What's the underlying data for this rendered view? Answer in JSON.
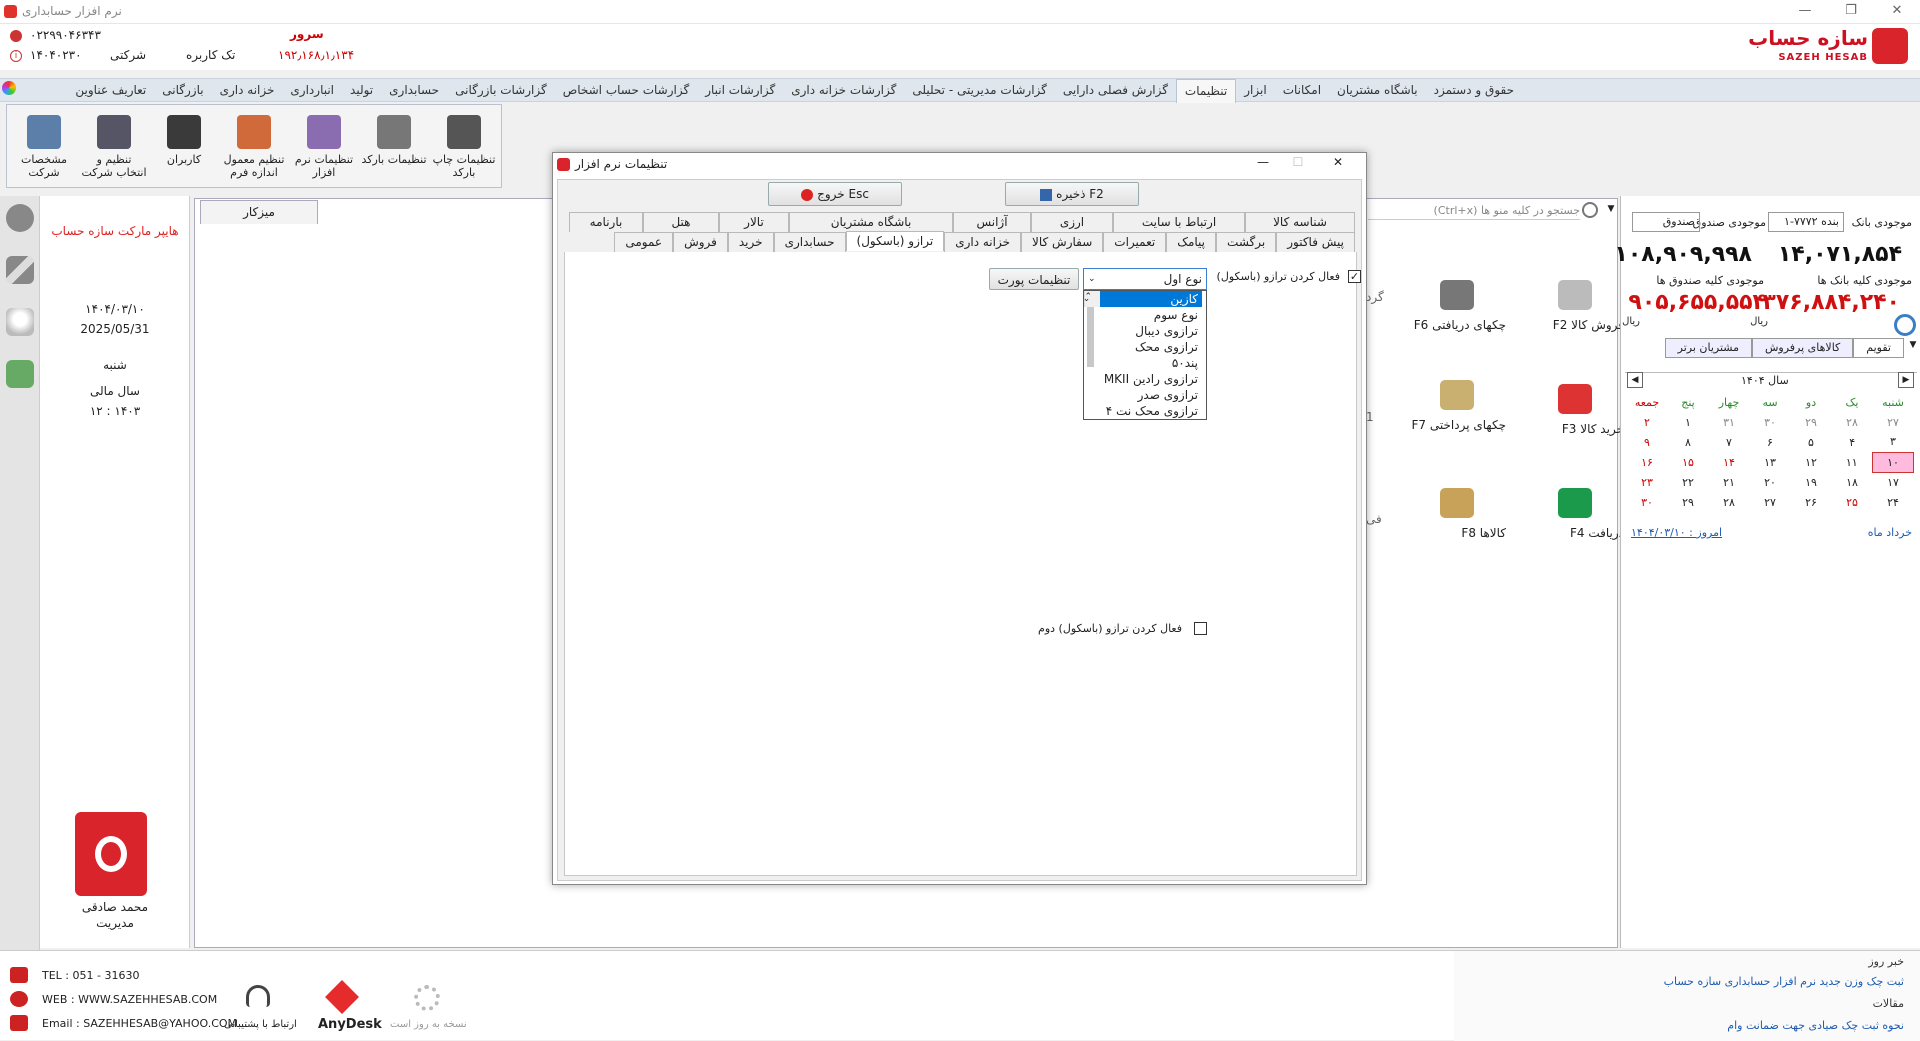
{
  "window": {
    "title": "نرم افزار حسابداری"
  },
  "header": {
    "phone": "۰۲۲۹۹۰۴۶۳۴۳",
    "company": "شرکتی",
    "users": "تک کاربره",
    "date_code": "۱۴۰۴۰۲۳۰",
    "server_label": "سرور",
    "server_ip": "۱۹۲٫۱۶۸٫۱٫۱۳۴",
    "logo_text": "سازه حساب",
    "logo_sub": "SAZEH HESAB"
  },
  "menu": [
    "حقوق و دستمزد",
    "باشگاه مشتریان",
    "امکانات",
    "ابزار",
    "تنظیمات",
    "گزارش فصلی دارایی",
    "گزارشات مدیریتی - تحلیلی",
    "گزارشات خزانه داری",
    "گزارشات انبار",
    "گزارشات حساب اشخاص",
    "گزارشات بازرگانی",
    "حسابداری",
    "تولید",
    "انبارداری",
    "خزانه داری",
    "بازرگانی",
    "تعاریف عناوین"
  ],
  "menu_active": "تنظیمات",
  "ribbon": [
    {
      "label": "تنظیمات چاپ بارکد",
      "icon": "barcode-print-icon",
      "color": "#555"
    },
    {
      "label": "تنظیمات بارکد",
      "icon": "barcode-icon",
      "color": "#777"
    },
    {
      "label": "تنظیمات نرم افزار",
      "icon": "software-settings-icon",
      "color": "#8a6db0"
    },
    {
      "label": "تنظیم معمول اندازه فرم",
      "icon": "form-size-icon",
      "color": "#d06a3a"
    },
    {
      "label": "کاربران",
      "icon": "users-icon",
      "color": "#3a3a3a"
    },
    {
      "label": "تنظیم و انتخاب شرکت",
      "icon": "company-select-icon",
      "color": "#556"
    },
    {
      "label": "مشخصات شرکت",
      "icon": "company-info-icon",
      "color": "#5b7fa8"
    }
  ],
  "left": {
    "brand": "هایپر مارکت سازه حساب",
    "date_fa": "۱۴۰۴/۰۳/۱۰",
    "date_en": "2025/05/31",
    "weekday": "شنبه",
    "fiscal_label": "سال مالی",
    "fiscal_value": "۱۲ : ۱۴۰۳",
    "user_name": "محمد صادقی",
    "user_role": "مدیریت"
  },
  "desk": {
    "tab": "میزکار",
    "search_placeholder": "جستجو در کلیه منو ها (Ctrl+x)",
    "shortcuts": [
      {
        "key": "F2",
        "label": "فروش کالا"
      },
      {
        "key": "F6",
        "label": "چکهای دریافتی"
      },
      {
        "key": "F3",
        "label": "خرید کالا"
      },
      {
        "key": "F7",
        "label": "چکهای پرداختی"
      },
      {
        "key": "F4",
        "label": "دریافت"
      },
      {
        "key": "F8",
        "label": "کالاها"
      }
    ],
    "partial": "گرد"
  },
  "right": {
    "bank_label": "موجودی بانک",
    "bank_select": "بنده ۷۷۷۲-۱",
    "cash_label": "موجودی صندوق",
    "cash_select": "صندوق",
    "bank_value": "۱۴,۰۷۱,۸۵۴",
    "cash_value": "۱۰۸,۹۰۹,۹۹۸",
    "all_banks_label": "موجودی کلیه بانک ها",
    "all_cash_label": "موجودی کلیه صندوق ها",
    "all_banks_value": "۳۷۶,۸۸۴,۲۴۰",
    "all_cash_value": "۹۰۵,۶۵۵,۵۵۴",
    "currency": "ریال",
    "tabs": [
      "تقویم",
      "کالاهای پرفروش",
      "مشتریان برتر"
    ],
    "year": "سال ۱۴۰۴",
    "weekdays": [
      "شنبه",
      "یک",
      "دو",
      "سه",
      "چهار",
      "پنج",
      "جمعه"
    ],
    "weeks": [
      [
        "۲۷",
        "۲۸",
        "۲۹",
        "۳۰",
        "۳۱",
        "۱",
        "۲"
      ],
      [
        "۳",
        "۴",
        "۵",
        "۶",
        "۷",
        "۸",
        "۹"
      ],
      [
        "۱۰",
        "۱۱",
        "۱۲",
        "۱۳",
        "۱۴",
        "۱۵",
        "۱۶"
      ],
      [
        "۱۷",
        "۱۸",
        "۱۹",
        "۲۰",
        "۲۱",
        "۲۲",
        "۲۳"
      ],
      [
        "۲۴",
        "۲۵",
        "۲۶",
        "۲۷",
        "۲۸",
        "۲۹",
        "۳۰"
      ]
    ],
    "month": "خرداد ماه",
    "today": "امروز : ۱۴۰۴/۰۳/۱۰"
  },
  "dialog": {
    "title": "تنظیمات نرم افزار",
    "save": "ذخیره F2",
    "exit": "خروج Esc",
    "tabs_row1": [
      "شناسه کالا",
      "ارتباط با سایت",
      "ارزی",
      "آژانس",
      "باشگاه مشتریان",
      "تالار",
      "هتل",
      "بارنامه"
    ],
    "tabs_row2": [
      "پیش فاکتور",
      "برگشت",
      "پیامک",
      "تعمیرات",
      "سفارش کالا",
      "خزانه داری",
      "ترازو (باسکول)",
      "حسابداری",
      "خرید",
      "فروش",
      "عمومی"
    ],
    "active_tab": "ترازو (باسکول)",
    "enable_scale": "فعال کردن ترازو (باسکول)",
    "enable_scale2": "فعال کردن ترازو (باسکول) دوم",
    "port_settings": "تنظیمات پورت",
    "combo_value": "نوع اول",
    "options": [
      "کازین",
      "نوع سوم",
      "ترازوی دیبال",
      "ترازوی محک",
      "پند۵۰",
      "ترازوی رادین MKII",
      "ترازوی صدر",
      "ترازوی محک نت ۴"
    ]
  },
  "bottom": {
    "tel": "TEL : 051 - 31630",
    "web": "WEB : WWW.SAZEHHESAB.COM",
    "email": "Email : SAZEHHESAB@YAHOO.COM",
    "support": "ارتباط با پشتیبانی",
    "anydesk": "AnyDesk",
    "update": "نسخه به روز است",
    "news_label": "خبر روز",
    "news": "ثبت چک وزن جدید نرم افزار حسابداری سازه حساب",
    "articles_label": "مقالات",
    "article": "نحوه ثبت چک صیادی جهت ضمانت وام"
  }
}
